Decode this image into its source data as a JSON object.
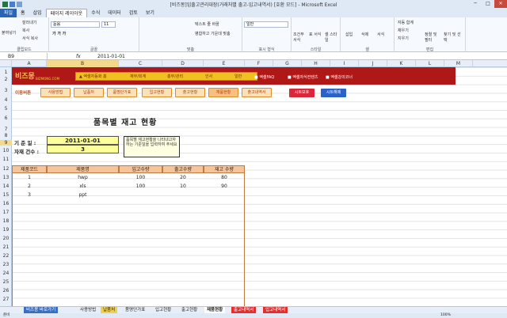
{
  "window": {
    "title": "[비즈몽]입출고관리대장(거래처별 출고-입고내역서) [호환 모드] - Microsoft Excel",
    "minimize": "─",
    "maximize": "□",
    "close": "✕"
  },
  "ribbon_tabs": [
    "파일",
    "홈",
    "삽입",
    "페이지 레이아웃",
    "수식",
    "데이터",
    "검토",
    "보기"
  ],
  "ribbon": {
    "clipboard": {
      "paste": "붙여넣기",
      "cut": "잘라내기",
      "copy": "복사",
      "format_painter": "서식 복사",
      "label": "클립보드"
    },
    "font": {
      "name": "돋움",
      "size": "11",
      "label": "글꼴"
    },
    "align": {
      "wrap": "텍스트 줄 바꿈",
      "merge": "병합하고 가운데 맞춤",
      "label": "맞춤"
    },
    "number": {
      "format": "일반",
      "label": "표시 형식"
    },
    "styles": {
      "cond": "조건부 서식",
      "table": "표 서식",
      "cell": "셀 스타일",
      "label": "스타일"
    },
    "cells": {
      "insert": "삽입",
      "delete": "삭제",
      "format": "서식",
      "label": "셀"
    },
    "edit": {
      "autosum": "자동 합계",
      "fill": "채우기",
      "clear": "지우기",
      "sort": "정렬 및 필터",
      "find": "찾기 및 선택",
      "label": "편집"
    }
  },
  "formula_bar": {
    "cell": "B9",
    "fx": "fx",
    "value": "2011-01-01"
  },
  "columns": [
    "A",
    "B",
    "C",
    "D",
    "E",
    "F",
    "G",
    "H",
    "I",
    "J",
    "K",
    "L",
    "M"
  ],
  "rows": [
    "1",
    "2",
    "3",
    "4",
    "5",
    "6",
    "7",
    "8",
    "9",
    "10",
    "11",
    "12",
    "13",
    "14",
    "15",
    "16",
    "17",
    "18",
    "19",
    "20",
    "21",
    "22",
    "23",
    "24",
    "25",
    "26",
    "27",
    "28"
  ],
  "banner": {
    "logo": "비즈몽",
    "logo_sub": "BIZMONG.COM",
    "menu": [
      "▲ 엑셀자동화 홈",
      "재무/회계",
      "총무/관리",
      "인사",
      "일반"
    ],
    "right": [
      "■ 엑셀FAQ",
      "■ 엑셀자식컨텐츠",
      "■ 엑셀강의코너"
    ]
  },
  "nav": {
    "title": "이동버튼",
    "buttons": [
      "사용방법",
      "납품처",
      "품명단가표",
      "입고현황",
      "출고현황",
      "재품현황",
      "출고내역서"
    ],
    "actions": [
      "시트보호",
      "시트해제"
    ]
  },
  "sheet": {
    "title": "품목별 재고 현황",
    "label_date": "기 준 일 :",
    "date": "2011-01-01",
    "label_count": "자재 건수 :",
    "count": "3",
    "note": "품목별 재고현황을 나타내고자하는 기준일을 입력하여 주세요"
  },
  "table": {
    "headers": [
      "제품코드",
      "제품명",
      "입고수량",
      "출고수량",
      "재고 수량"
    ],
    "rows": [
      {
        "code": "1",
        "name": "hwp",
        "in": "100",
        "out": "20",
        "stock": "80"
      },
      {
        "code": "2",
        "name": "xls",
        "in": "100",
        "out": "10",
        "stock": "90"
      },
      {
        "code": "3",
        "name": "ppt",
        "in": "",
        "out": "",
        "stock": ""
      }
    ]
  },
  "sheet_tabs": [
    "비즈몽 바로가기",
    "사용방법",
    "납품처",
    "품명단가표",
    "입고현황",
    "출고현황",
    "재품현황",
    "출고내역서",
    "입고내역서"
  ],
  "status": {
    "left": "준비",
    "zoom": "100%"
  }
}
